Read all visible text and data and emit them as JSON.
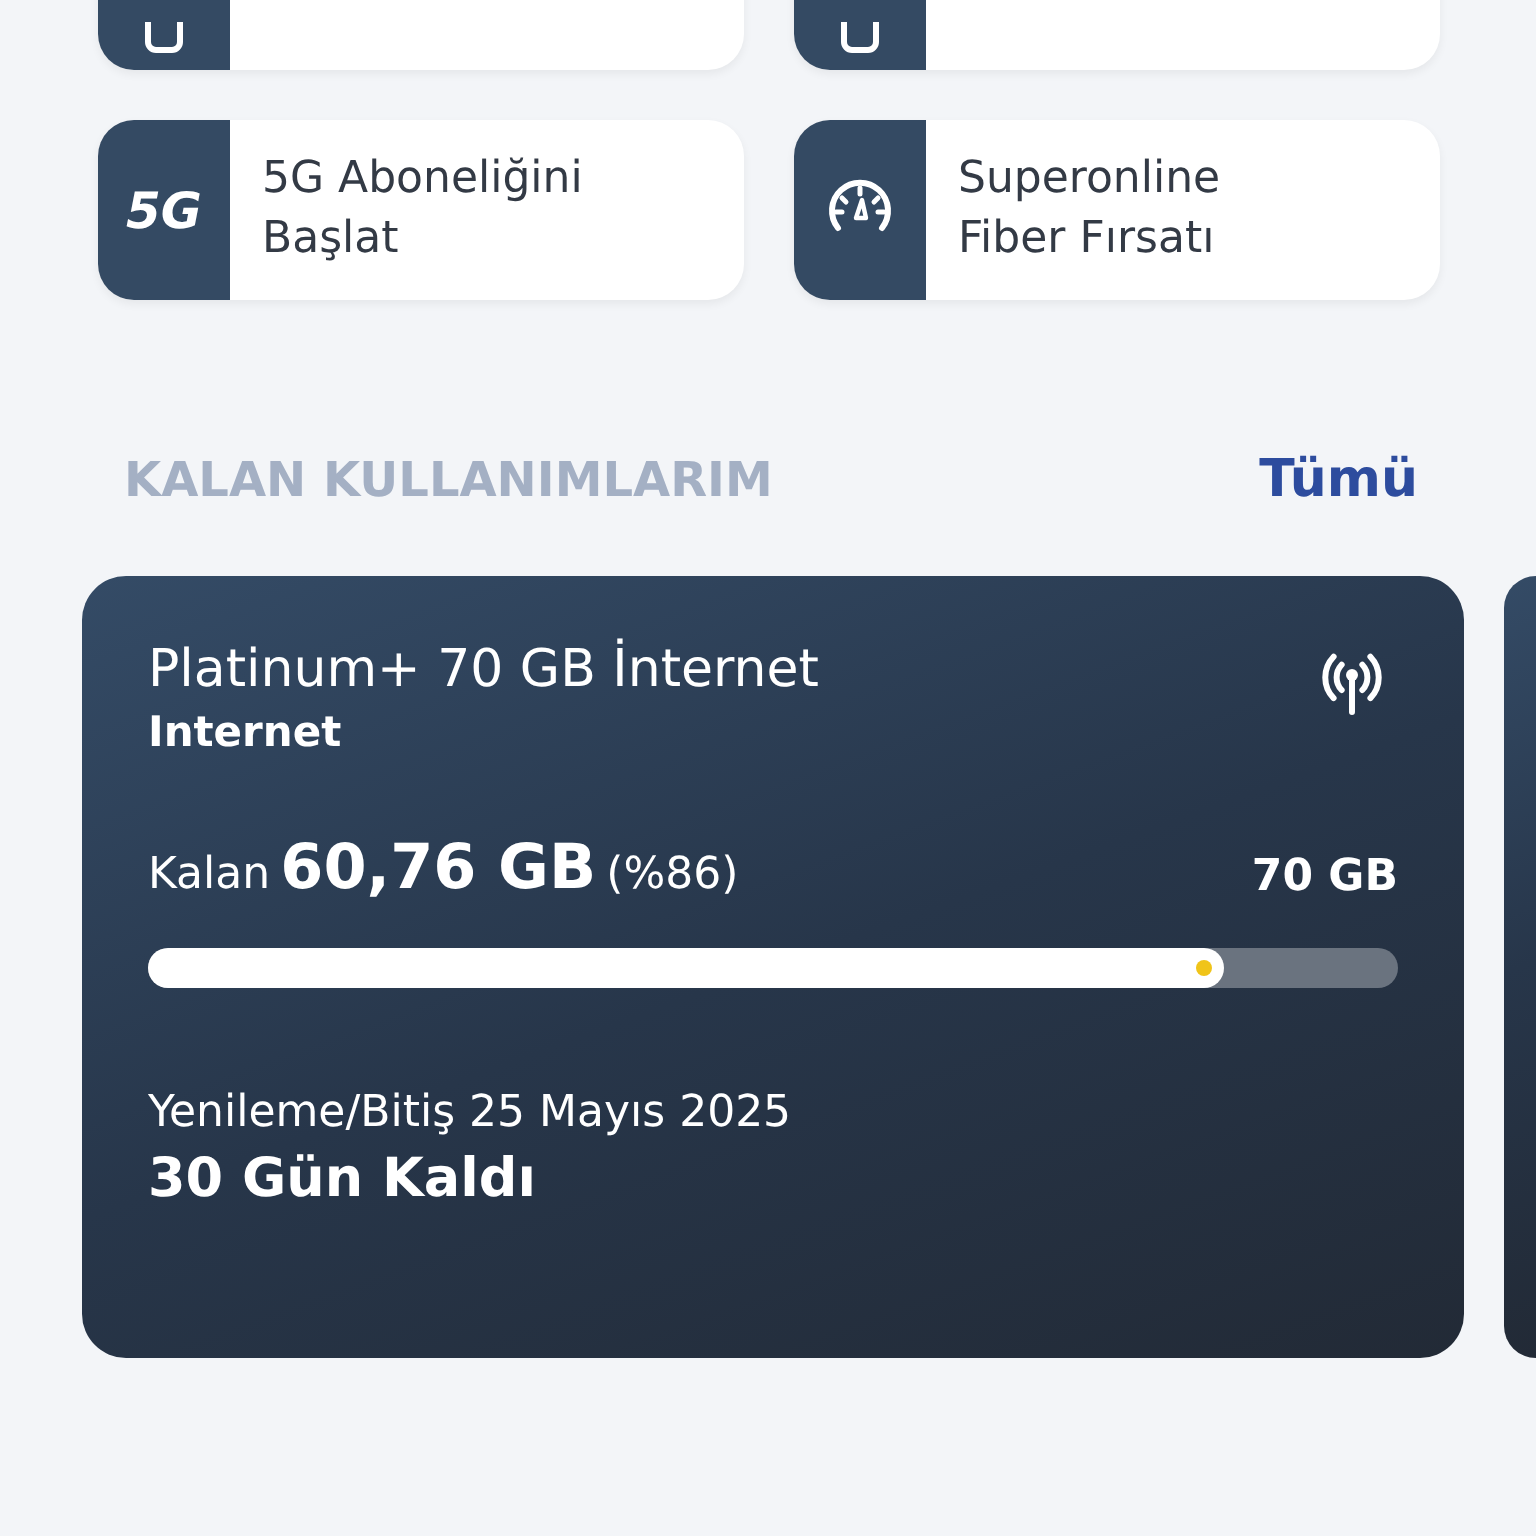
{
  "shortcuts": [
    {
      "kind": "device"
    },
    {
      "kind": "device"
    },
    {
      "kind": "text",
      "icon_text": "5G",
      "lines": [
        "5G Aboneliğini",
        "Başlat"
      ]
    },
    {
      "kind": "gauge",
      "lines": [
        "Superonline",
        "Fiber Fırsatı"
      ]
    }
  ],
  "usage_section": {
    "title": "KALAN KULLANIMLARIM",
    "link": "Tümü",
    "cards": [
      {
        "name": "Platinum+ 70 GB İnternet",
        "type": "Internet",
        "remaining_label": "Kalan",
        "remaining": "60,76 GB",
        "percent": "(%86)",
        "total": "70 GB",
        "level": 0.86,
        "renewal": "Yenileme/Bitiş 25 Mayıs 2025",
        "days_left": "30 Gün Kaldı"
      }
    ]
  }
}
